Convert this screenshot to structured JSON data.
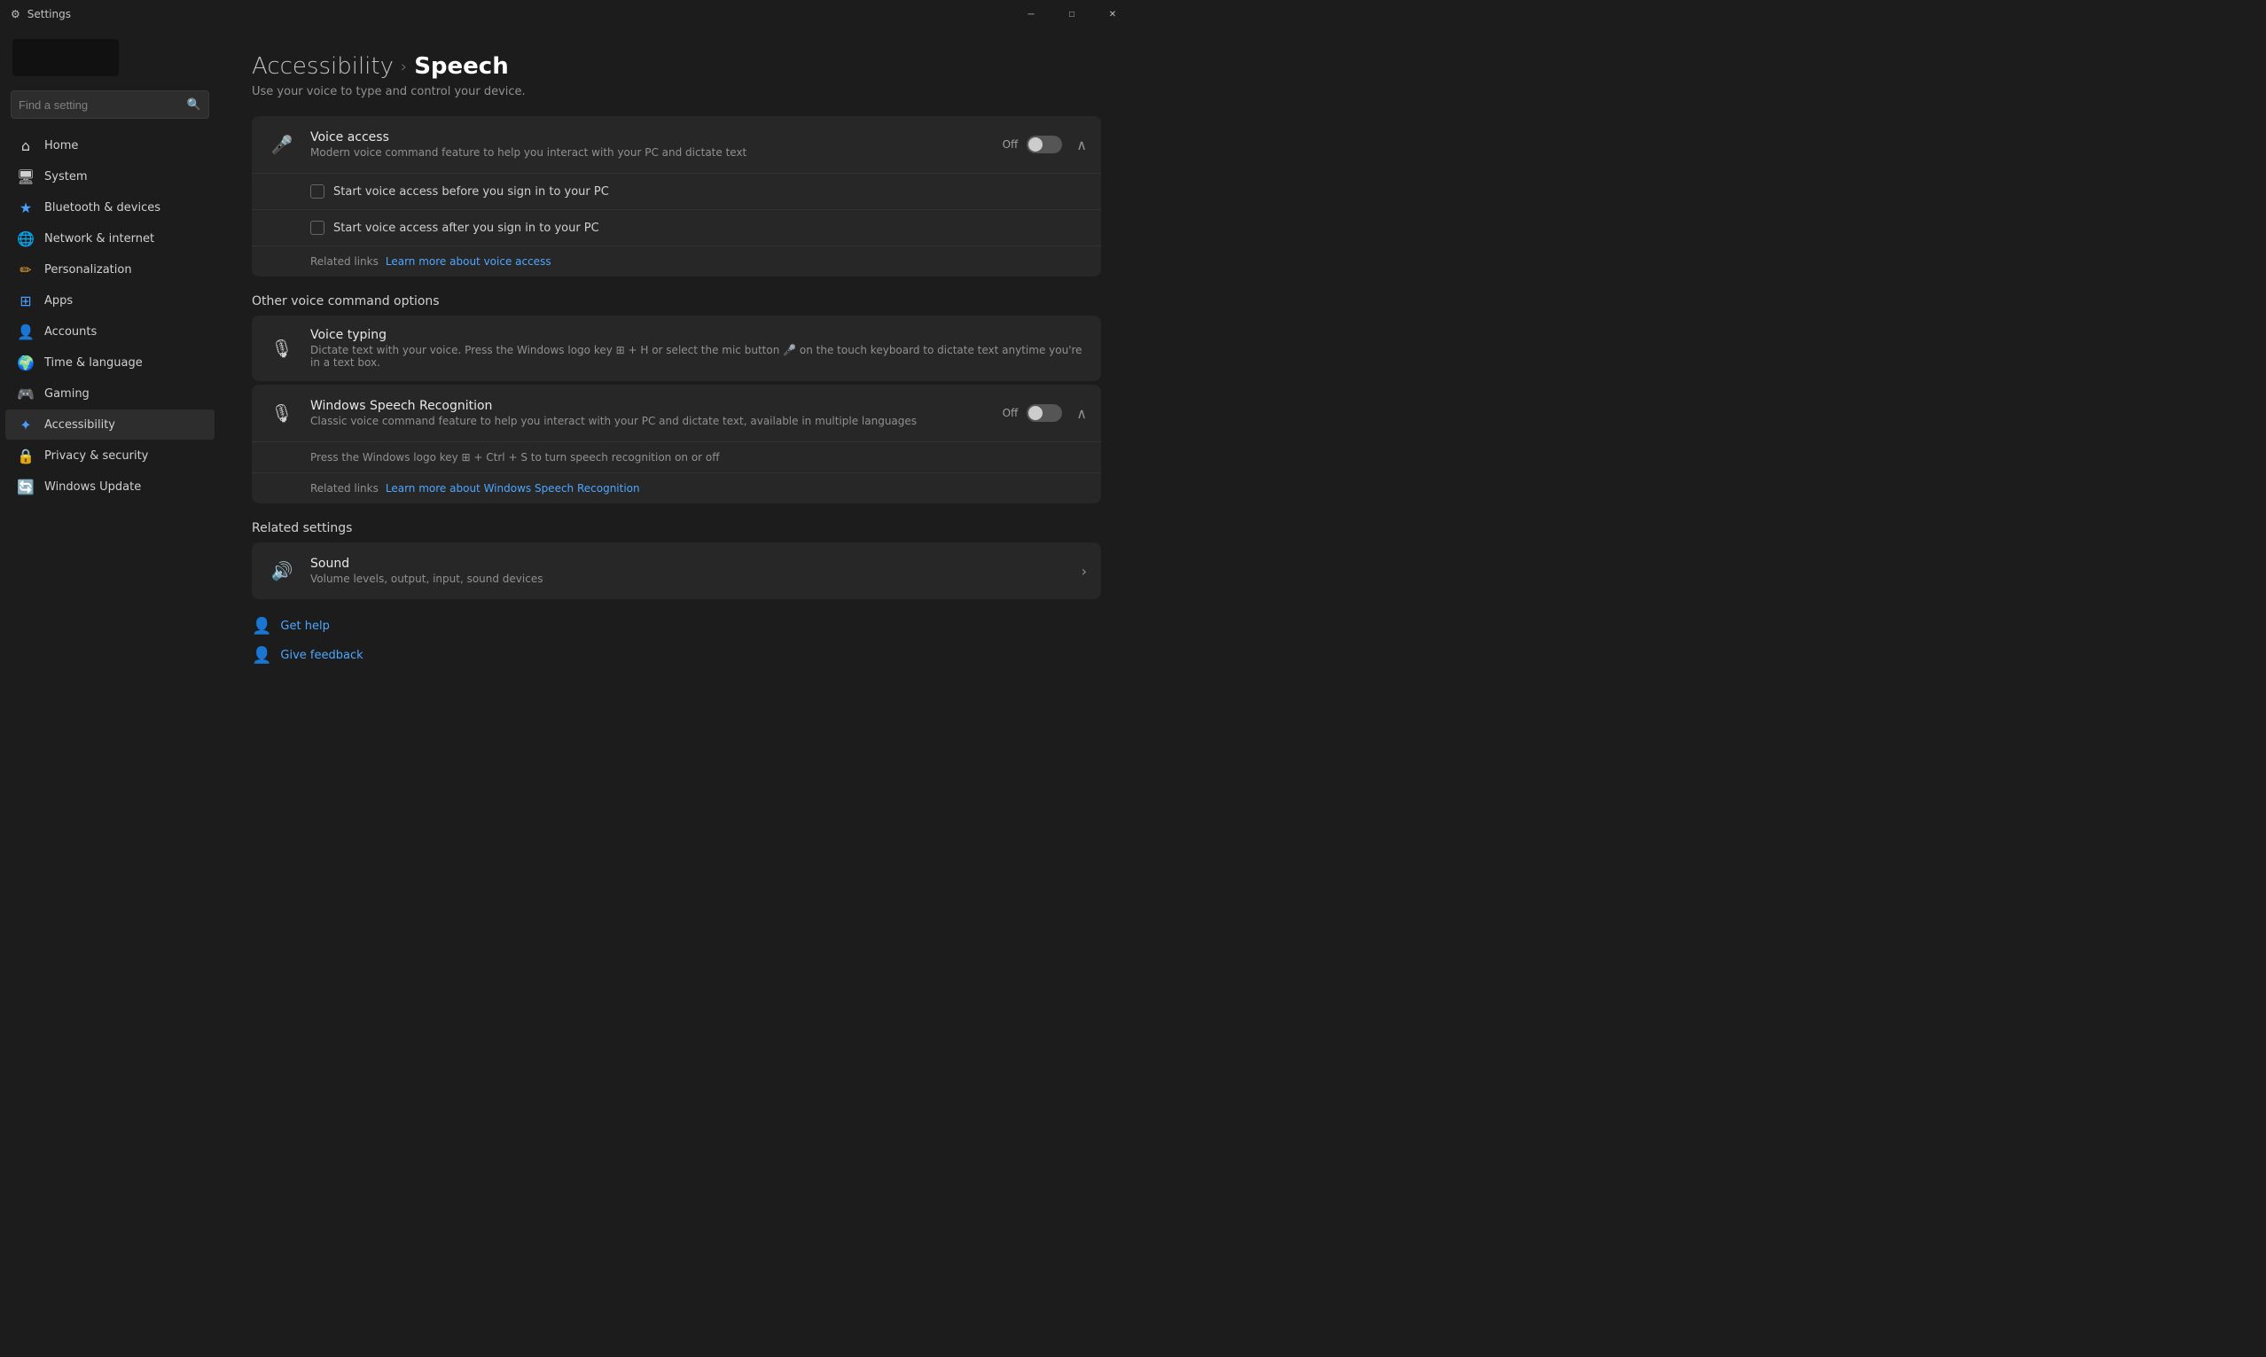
{
  "titlebar": {
    "title": "Settings",
    "minimize": "─",
    "maximize": "□",
    "close": "✕"
  },
  "sidebar": {
    "search_placeholder": "Find a setting",
    "nav_items": [
      {
        "id": "home",
        "icon": "⌂",
        "label": "Home",
        "active": false
      },
      {
        "id": "system",
        "icon": "💻",
        "label": "System",
        "active": false
      },
      {
        "id": "bluetooth",
        "icon": "⬡",
        "label": "Bluetooth & devices",
        "active": false
      },
      {
        "id": "network",
        "icon": "🌐",
        "label": "Network & internet",
        "active": false
      },
      {
        "id": "personalization",
        "icon": "✏️",
        "label": "Personalization",
        "active": false
      },
      {
        "id": "apps",
        "icon": "📦",
        "label": "Apps",
        "active": false
      },
      {
        "id": "accounts",
        "icon": "👤",
        "label": "Accounts",
        "active": false
      },
      {
        "id": "time",
        "icon": "🌍",
        "label": "Time & language",
        "active": false
      },
      {
        "id": "gaming",
        "icon": "🎮",
        "label": "Gaming",
        "active": false
      },
      {
        "id": "accessibility",
        "icon": "♿",
        "label": "Accessibility",
        "active": true
      },
      {
        "id": "privacy",
        "icon": "🔒",
        "label": "Privacy & security",
        "active": false
      },
      {
        "id": "windowsupdate",
        "icon": "🔄",
        "label": "Windows Update",
        "active": false
      }
    ]
  },
  "page": {
    "breadcrumb_parent": "Accessibility",
    "breadcrumb_sep": "›",
    "breadcrumb_current": "Speech",
    "subtitle": "Use your voice to type and control your device."
  },
  "voice_access": {
    "title": "Voice access",
    "description": "Modern voice command feature to help you interact with your PC and dictate text",
    "toggle_label": "Off",
    "toggle_state": "off",
    "sub1_label": "Start voice access before you sign in to your PC",
    "sub2_label": "Start voice access after you sign in to your PC",
    "related_links_label": "Related links",
    "learn_more_link": "Learn more about voice access"
  },
  "other_section": {
    "heading": "Other voice command options"
  },
  "voice_typing": {
    "title": "Voice typing",
    "description": "Dictate text with your voice. Press the Windows logo key ⊞ + H or select the mic button 🎤 on the touch keyboard to dictate text anytime you're in a text box."
  },
  "speech_recognition": {
    "title": "Windows Speech Recognition",
    "description": "Classic voice command feature to help you interact with your PC and dictate text, available in multiple languages",
    "toggle_label": "Off",
    "toggle_state": "off",
    "body_text": "Press the Windows logo key ⊞ + Ctrl + S to turn speech recognition on or off",
    "related_links_label": "Related links",
    "learn_more_link": "Learn more about Windows Speech Recognition"
  },
  "related_settings": {
    "heading": "Related settings",
    "sound": {
      "title": "Sound",
      "description": "Volume levels, output, input, sound devices"
    }
  },
  "footer": {
    "get_help_label": "Get help",
    "give_feedback_label": "Give feedback"
  }
}
